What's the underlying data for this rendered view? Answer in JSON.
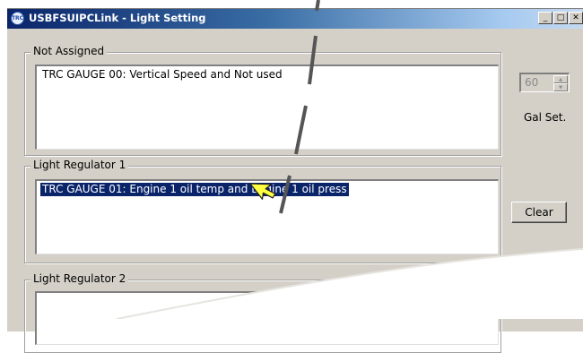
{
  "window": {
    "title": "USBFSUIPCLink - Light Setting",
    "app_icon_text": "TRC",
    "buttons": {
      "minimize": "_",
      "maximize": "□",
      "close": "✕"
    }
  },
  "groups": {
    "not_assigned": {
      "label": "Not Assigned",
      "items": [
        "TRC GAUGE 00: Vertical Speed and Not used"
      ]
    },
    "light_regulator_1": {
      "label": "Light Regulator 1",
      "items": [
        "TRC GAUGE 01: Engine 1 oil temp and Engine 1 oil press"
      ]
    },
    "light_regulator_2": {
      "label": "Light Regulator 2"
    }
  },
  "gal": {
    "stepper_value": "60",
    "label": "Gal Set."
  },
  "clear_button": {
    "label": "Clear"
  },
  "cursor": {
    "name": "pointer-arrow-icon",
    "color": "#ffff40"
  },
  "drag_trail": {
    "color": "#555555"
  }
}
